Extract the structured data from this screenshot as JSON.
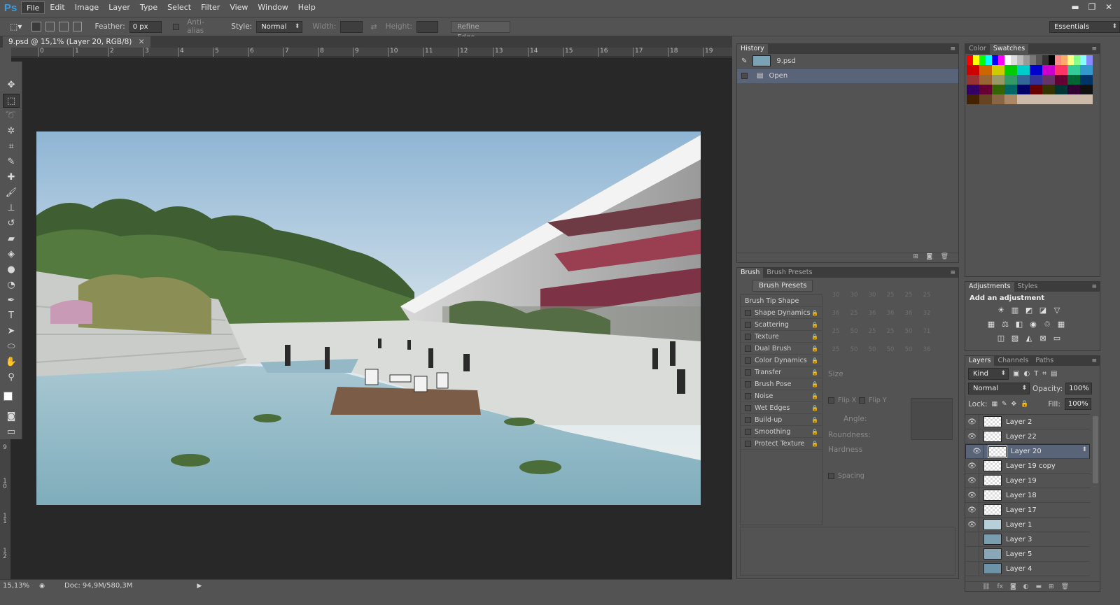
{
  "app": {
    "logo": "Ps"
  },
  "menubar": {
    "items": [
      "File",
      "Edit",
      "Image",
      "Layer",
      "Type",
      "Select",
      "Filter",
      "View",
      "Window",
      "Help"
    ]
  },
  "window_controls": {
    "minimize": "▬",
    "restore": "❐",
    "close": "✕"
  },
  "options": {
    "feather_label": "Feather:",
    "feather_value": "0 px",
    "antialias_label": "Anti-alias",
    "style_label": "Style:",
    "style_value": "Normal",
    "width_label": "Width:",
    "height_label": "Height:",
    "refine_edge": "Refine Edge...",
    "workspace": "Essentials"
  },
  "document": {
    "tab_title": "9.psd @ 15,1% (Layer 20, RGB/8)",
    "ruler_h": [
      "0",
      "1",
      "2",
      "3",
      "4",
      "5",
      "6",
      "7",
      "8",
      "9",
      "10",
      "11",
      "12",
      "13",
      "14",
      "15",
      "16",
      "17",
      "18",
      "19"
    ],
    "ruler_v": [
      "9",
      "1 0",
      "1 1",
      "1 2"
    ],
    "zoom": "15,13%",
    "doc_size": "Doc: 94,9M/580,3M"
  },
  "history": {
    "tab": "History",
    "snapshot": "9.psd",
    "states": [
      "Open"
    ]
  },
  "brush": {
    "tabs": [
      "Brush",
      "Brush Presets"
    ],
    "presets_button": "Brush Presets",
    "options": [
      "Brush Tip Shape",
      "Shape Dynamics",
      "Scattering",
      "Texture",
      "Dual Brush",
      "Color Dynamics",
      "Transfer",
      "Brush Pose",
      "Noise",
      "Wet Edges",
      "Build-up",
      "Smoothing",
      "Protect Texture"
    ],
    "tip_sizes": [
      "30",
      "30",
      "30",
      "25",
      "25",
      "25",
      "36",
      "25",
      "36",
      "36",
      "36",
      "32",
      "25",
      "50",
      "25",
      "25",
      "50",
      "71",
      "25",
      "50",
      "50",
      "50",
      "50",
      "36"
    ],
    "size_label": "Size",
    "flipx": "Flip X",
    "flipy": "Flip Y",
    "angle_label": "Angle:",
    "roundness_label": "Roundness:",
    "hardness_label": "Hardness",
    "spacing_label": "Spacing"
  },
  "color": {
    "tabs": [
      "Color",
      "Swatches"
    ]
  },
  "adjustments": {
    "tabs": [
      "Adjustments",
      "Styles"
    ],
    "title": "Add an adjustment"
  },
  "layers": {
    "tabs": [
      "Layers",
      "Channels",
      "Paths"
    ],
    "kind": "Kind",
    "blend": "Normal",
    "opacity_label": "Opacity:",
    "opacity": "100%",
    "lock_label": "Lock:",
    "fill_label": "Fill:",
    "fill": "100%",
    "rows": [
      {
        "name": "Layer 2",
        "visible": true
      },
      {
        "name": "Layer 22",
        "visible": true
      },
      {
        "name": "Layer 20",
        "visible": true,
        "selected": true
      },
      {
        "name": "Layer 19 copy",
        "visible": true
      },
      {
        "name": "Layer 19",
        "visible": true
      },
      {
        "name": "Layer 18",
        "visible": true
      },
      {
        "name": "Layer 17",
        "visible": true
      },
      {
        "name": "Layer 1",
        "visible": true
      },
      {
        "name": "Layer 3",
        "visible": false
      },
      {
        "name": "Layer 5",
        "visible": false
      },
      {
        "name": "Layer 4",
        "visible": false
      }
    ]
  }
}
